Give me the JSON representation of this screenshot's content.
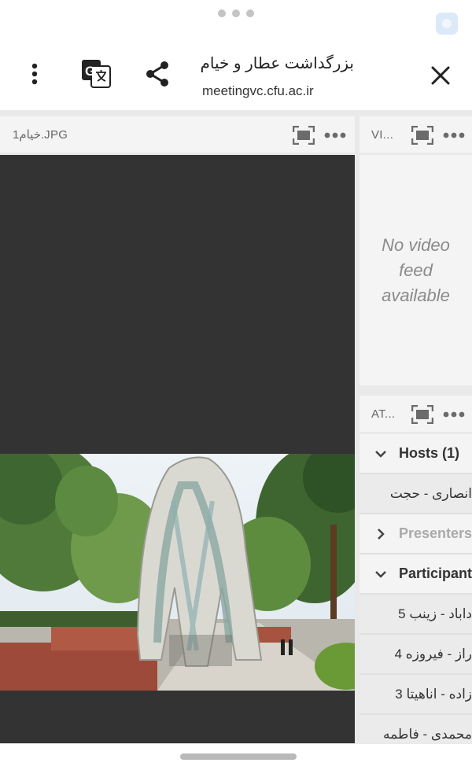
{
  "header": {
    "title": "بزرگداشت عطار و خیام",
    "url": "meetingvc.cfu.ac.ir",
    "menu_icon": "more-vertical-icon",
    "translate_icon": "google-translate-icon",
    "share_icon": "share-icon",
    "close_icon": "close-icon"
  },
  "share_panel": {
    "title": "خیام1.JPG",
    "fullscreen_icon": "fullscreen-icon",
    "more_icon": "more-horizontal-icon"
  },
  "video_panel": {
    "title": "VI...",
    "no_feed_text": "No video feed available",
    "fullscreen_icon": "fullscreen-icon",
    "more_icon": "more-horizontal-icon"
  },
  "attendees_panel": {
    "title": "AT...",
    "fullscreen_icon": "fullscreen-icon",
    "more_icon": "more-horizontal-icon",
    "groups": {
      "hosts": {
        "label": "Hosts (1)",
        "expanded": true
      },
      "presenters": {
        "label": "Presenters",
        "expanded": false
      },
      "participants": {
        "label": "Participant",
        "expanded": true
      }
    },
    "host_names": [
      "انصاری - حجت"
    ],
    "participant_names": [
      "داباد - زینب 5",
      "راز - فیروزه 4",
      "زاده - اناهیتا 3",
      "محمدی - فاطمه"
    ]
  },
  "colors": {
    "stage_background": "#333333",
    "panel_header": "#f4f4f4",
    "gray_frame": "#e9e9e9"
  }
}
